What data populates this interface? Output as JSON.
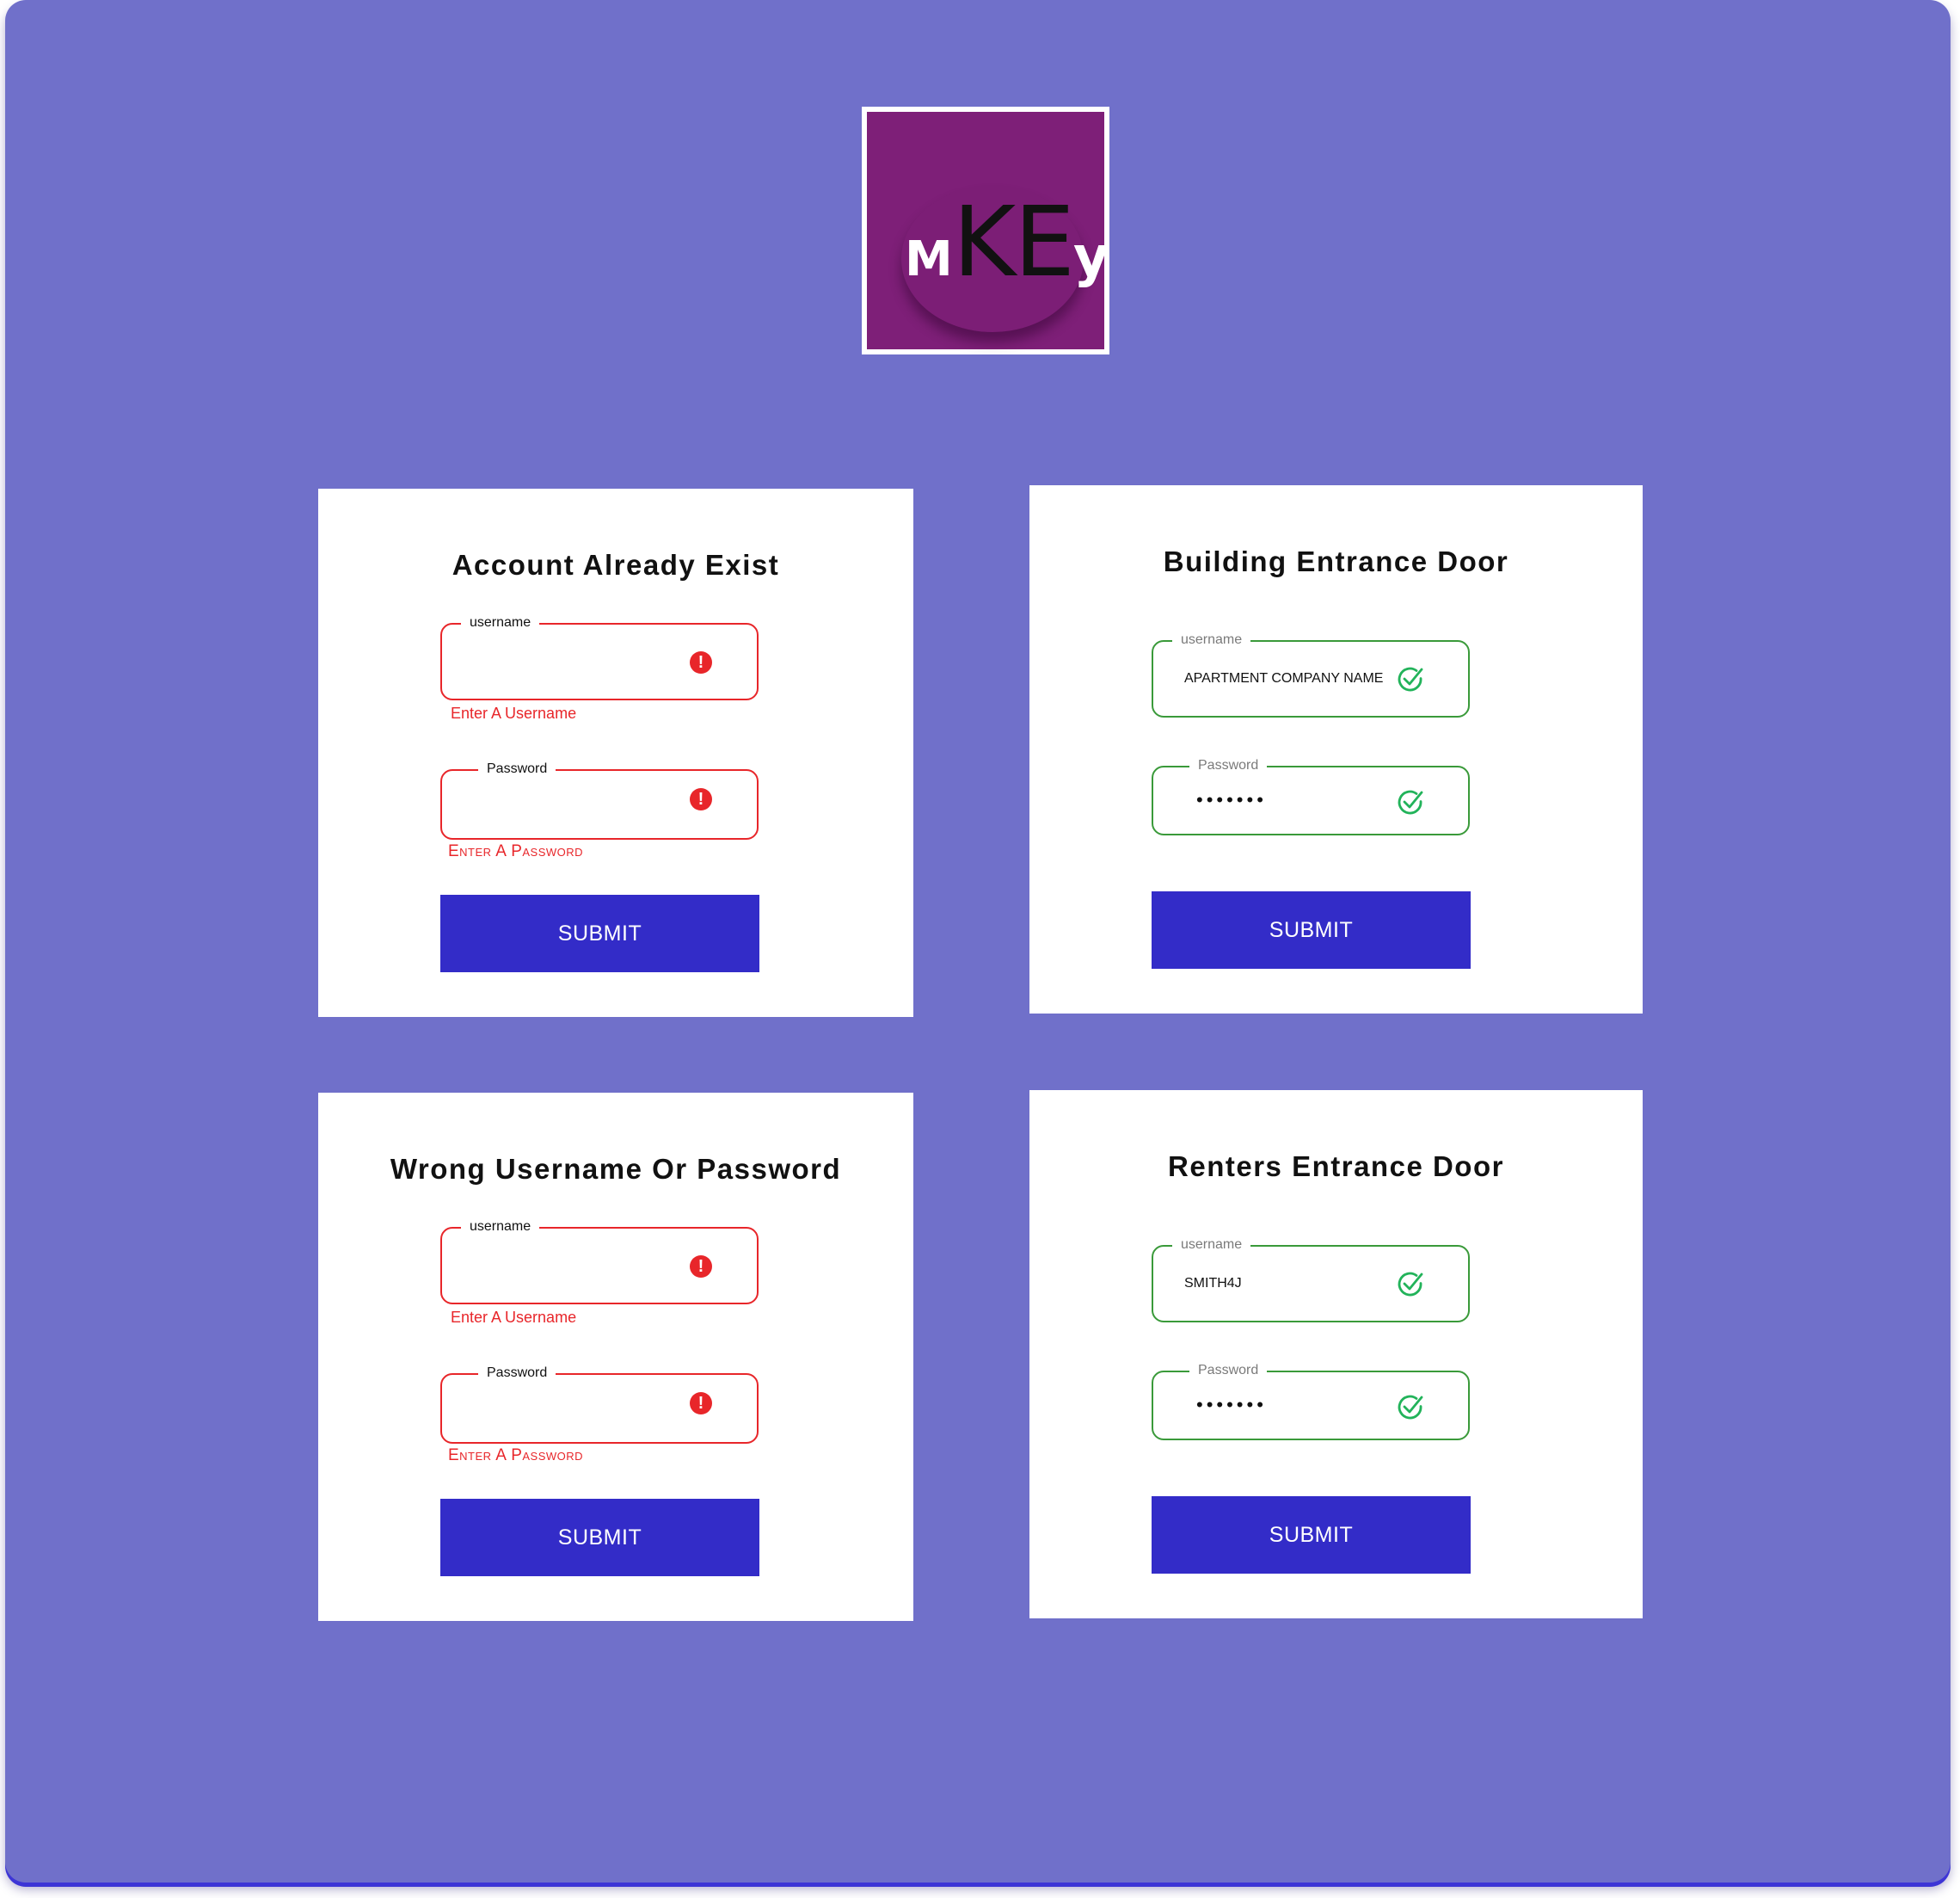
{
  "logo": {
    "text_m": "M",
    "text_ke": "KE",
    "text_y": "y",
    "background_color": "#7e1f78"
  },
  "cards": [
    {
      "title": "Account Already Exist",
      "state": "error",
      "username": {
        "label": "username",
        "value": "",
        "helper": "Enter A Username"
      },
      "password": {
        "label": "Password",
        "value": "",
        "helper": "Enter  A Password"
      },
      "submit_label": "SUBMIT"
    },
    {
      "title": "Building Entrance Door",
      "state": "success",
      "username": {
        "label": "username",
        "value": "APARTMENT COMPANY NAME"
      },
      "password": {
        "label": "Password",
        "value": "•••••••"
      },
      "submit_label": "SUBMIT"
    },
    {
      "title": "Wrong Username Or Password",
      "state": "error",
      "username": {
        "label": "username",
        "value": "",
        "helper": "Enter A Username"
      },
      "password": {
        "label": "Password",
        "value": "",
        "helper": "Enter  A Password"
      },
      "submit_label": "SUBMIT"
    },
    {
      "title": "Renters Entrance Door",
      "state": "success",
      "username": {
        "label": "username",
        "value": "SMITH4J"
      },
      "password": {
        "label": "Password",
        "value": "•••••••"
      },
      "submit_label": "SUBMIT"
    }
  ],
  "icons": {
    "error": "exclamation-circle-icon",
    "success": "check-circle-icon"
  },
  "colors": {
    "background": "#7070ca",
    "error": "#e8262a",
    "success_border": "#3a9a3a",
    "success_icon": "#22b35a",
    "button": "#332cc8"
  }
}
